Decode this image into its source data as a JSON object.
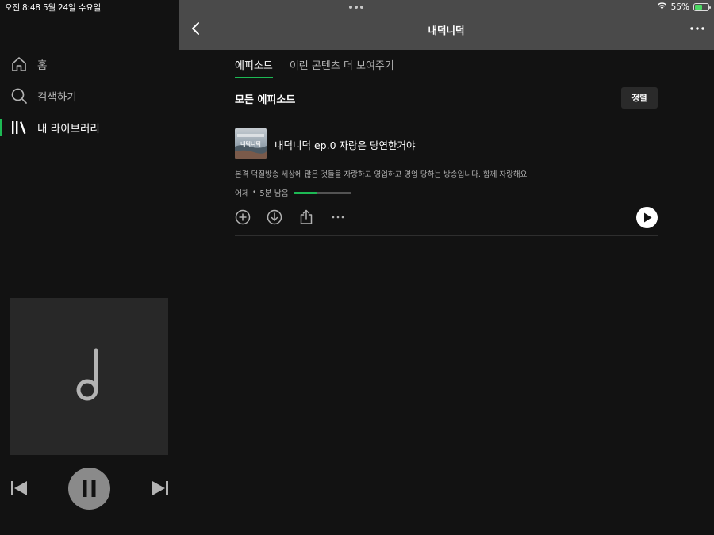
{
  "status_bar": {
    "time_date": "오전 8:48  5월 24일 수요일",
    "battery_percent": "55%",
    "battery_level": 0.55
  },
  "sidebar": {
    "items": [
      {
        "label": "홈",
        "icon": "home-icon",
        "active": false
      },
      {
        "label": "검색하기",
        "icon": "search-icon",
        "active": false
      },
      {
        "label": "내 라이브러리",
        "icon": "library-icon",
        "active": true
      }
    ]
  },
  "player": {
    "state": "playing",
    "art_icon": "music-note-icon"
  },
  "header": {
    "title": "내덕니덕"
  },
  "tabs": [
    {
      "label": "에피소드",
      "active": true
    },
    {
      "label": "이런 콘텐츠 더 보여주기",
      "active": false
    }
  ],
  "section": {
    "title": "모든 에피소드",
    "sort_label": "정렬"
  },
  "episodes": [
    {
      "title": "내덕니덕 ep.0 자랑은 당연한거야",
      "thumb_text": "내덕니덕",
      "description": "본격 덕질방송 세상에 많은 것들을 자랑하고 영업하고 영업 당하는 방송입니다. 함께 자랑해요",
      "date": "어제",
      "separator": "•",
      "remaining": "5분 남음",
      "progress": 0.42
    }
  ],
  "colors": {
    "accent": "#1db954",
    "background": "#121212",
    "topbar": "#4a4a4a",
    "battery": "#4cd964"
  }
}
